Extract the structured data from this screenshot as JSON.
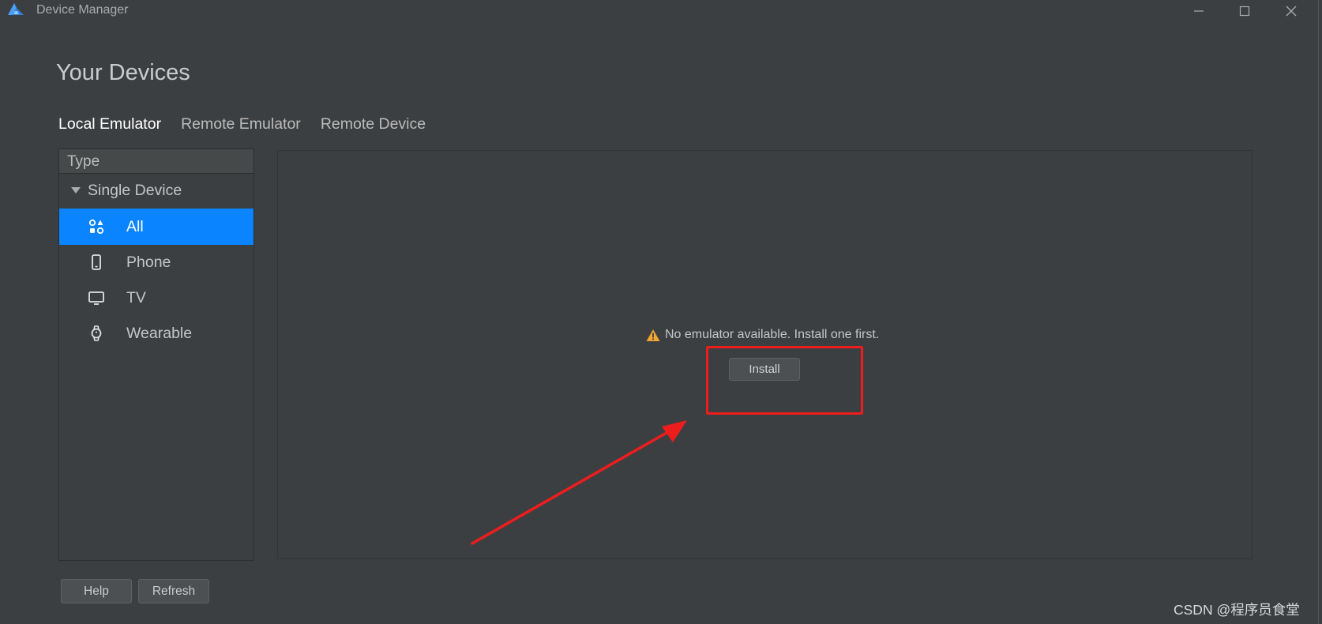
{
  "window": {
    "title": "Device Manager",
    "controls": [
      "minimize-icon",
      "maximize-icon",
      "close-icon"
    ]
  },
  "page": {
    "title": "Your Devices"
  },
  "tabs": [
    {
      "label": "Local Emulator",
      "active": true
    },
    {
      "label": "Remote Emulator",
      "active": false
    },
    {
      "label": "Remote Device",
      "active": false
    }
  ],
  "type_panel": {
    "header": "Type",
    "group": {
      "label": "Single Device",
      "expanded": true
    },
    "items": [
      {
        "label": "All",
        "icon": "grid-shapes-icon",
        "selected": true
      },
      {
        "label": "Phone",
        "icon": "phone-icon",
        "selected": false
      },
      {
        "label": "TV",
        "icon": "tv-icon",
        "selected": false
      },
      {
        "label": "Wearable",
        "icon": "watch-icon",
        "selected": false
      }
    ]
  },
  "content": {
    "empty_message": "No emulator available. Install one first.",
    "message_icon": "warning-icon",
    "install_label": "Install"
  },
  "footer": {
    "help_label": "Help",
    "refresh_label": "Refresh"
  },
  "watermark": "CSDN @程序员食堂",
  "colors": {
    "background": "#3c3f41",
    "selection": "#0a84ff",
    "warning": "#f0a732",
    "annotation": "#ee1d1d"
  }
}
